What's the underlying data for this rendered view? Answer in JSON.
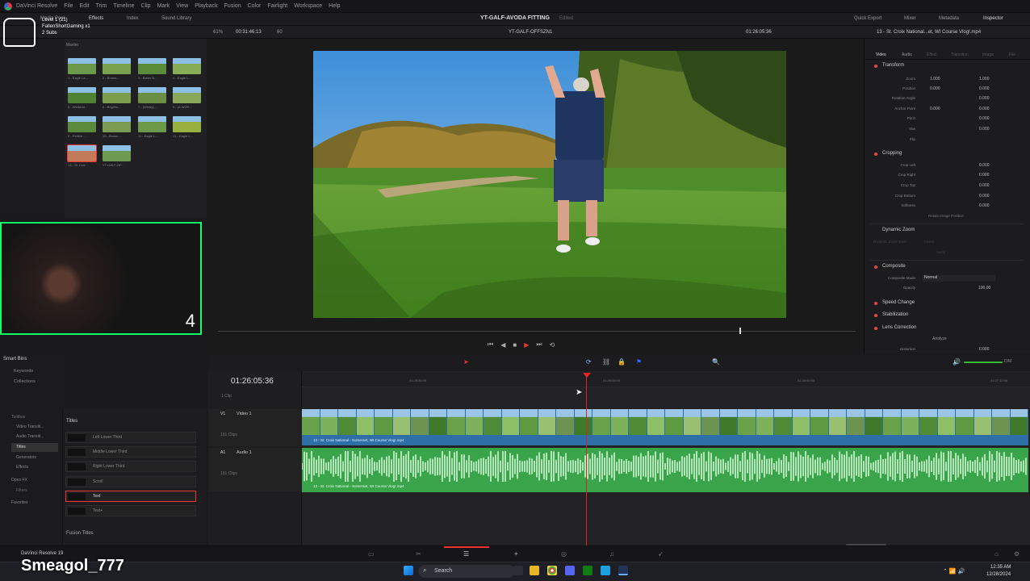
{
  "app": {
    "name": "DaVinci Resolve",
    "project_title": "YT-GALF-AVODA FITTING",
    "project_status": "Edited",
    "footer_brand": "DaVinci Resolve 19"
  },
  "menu": [
    "DaVinci Resolve",
    "File",
    "Edit",
    "Trim",
    "Timeline",
    "Clip",
    "Mark",
    "View",
    "Playback",
    "Fusion",
    "Color",
    "Fairlight",
    "Workspace",
    "Help"
  ],
  "toolbar": {
    "left": [
      "Media Pool",
      "Effects",
      "Index",
      "Sound Library"
    ],
    "right": [
      "Quick Export",
      "Mixer",
      "Metadata",
      "Inspector"
    ]
  },
  "channel_overlay": {
    "line1": "Level 1 (21)",
    "line2": "FallenShortGaming x1",
    "line3": "2 Subs",
    "streamer": "Smeagol_777",
    "cam_number": "4"
  },
  "viewer": {
    "zoom": "61%",
    "source_timecode": "00:31:46:13",
    "fps": "60",
    "timeline_name": "YT-GALF-OFFSZN1",
    "timecode": "01:26:05:36",
    "clip_name": "13 - St. Croix National...et, WI Course Vlog!.mp4"
  },
  "media_pool": {
    "folder": "Master",
    "clips": [
      "1 - Eagle La...",
      "2 - Brown...",
      "3 - Baker N...",
      "4 - Eagle L...",
      "5 - Wildwod...",
      "6 - Brightw...",
      "7 - (Windy)...",
      "8 - (A WOR...",
      "9 - Pebble ...",
      "10 - Brown...",
      "11 - Eagle L...",
      "12 - Eagle L...",
      "13 - St. Croi...",
      "YT-GALF-OF..."
    ]
  },
  "smart_bins": {
    "title": "Smart Bins",
    "items": [
      "Keywords",
      "Collections"
    ]
  },
  "effects_nav": [
    "Toolbox",
    "Video Transiti...",
    "Audio Transiti...",
    "Titles",
    "Generators",
    "Effects",
    "Open FX",
    "Filters",
    "Favorites"
  ],
  "titles": {
    "header": "Titles",
    "items": [
      "Left Lower Third",
      "Middle Lower Third",
      "Right Lower Third",
      "Scroll",
      "Text",
      "Text+"
    ],
    "fusion_header": "Fusion Titles"
  },
  "inspector": {
    "tabs": [
      "Video",
      "Audio",
      "Effect",
      "Transition",
      "Image",
      "File"
    ],
    "transform": {
      "title": "Transform",
      "zoom_label": "Zoom",
      "zoom_x": "1.000",
      "zoom_y": "1.000",
      "position_label": "Position",
      "pos_x": "0.000",
      "pos_y": "0.000",
      "rotation_label": "Rotation Angle",
      "rotation": "0.000",
      "anchor_label": "Anchor Point",
      "anchor_x": "0.000",
      "anchor_y": "0.000",
      "pitch_label": "Pitch",
      "pitch": "0.000",
      "yaw_label": "Yaw",
      "yaw": "0.000",
      "flip_label": "Flip"
    },
    "cropping": {
      "title": "Cropping",
      "left_label": "Crop Left",
      "left": "0.000",
      "right_label": "Crop Right",
      "right": "0.000",
      "top_label": "Crop Top",
      "top": "0.000",
      "bottom_label": "Crop Bottom",
      "bottom": "0.000",
      "soft_label": "Softness",
      "soft": "0.000",
      "retain": "Retain Image Position"
    },
    "dynamic_zoom": {
      "title": "Dynamic Zoom",
      "ease_label": "Dynamic Zoom Ease",
      "ease": "Linear",
      "swap": "Swap"
    },
    "composite": {
      "title": "Composite",
      "mode_label": "Composite Mode",
      "mode": "Normal",
      "opacity_label": "Opacity",
      "opacity": "100.00"
    },
    "speed_change": "Speed Change",
    "stabilization": "Stabilization",
    "lens_correction": {
      "title": "Lens Correction",
      "analyze": "Analyze",
      "distortion_label": "Distortion",
      "distortion": "0.000"
    }
  },
  "timeline": {
    "timecode": "01:26:05:36",
    "clip_count": "1 Clip",
    "v1": {
      "id": "V1",
      "name": "Video 1",
      "clips": "151 Clips"
    },
    "a1": {
      "id": "A1",
      "name": "Audio 1",
      "clips": "151 Clips"
    },
    "clip_label": "13 - St. Croix National - Somerset, WI Course Vlog!.mp4",
    "ruler_ticks": [
      "01:25:36:00",
      "01:26:08:00",
      "01:26:40:00",
      "01:27:12:00"
    ],
    "volume_label": "DIM"
  },
  "taskbar": {
    "search": "Search",
    "time": "12:35 AM",
    "date": "12/28/2024"
  }
}
